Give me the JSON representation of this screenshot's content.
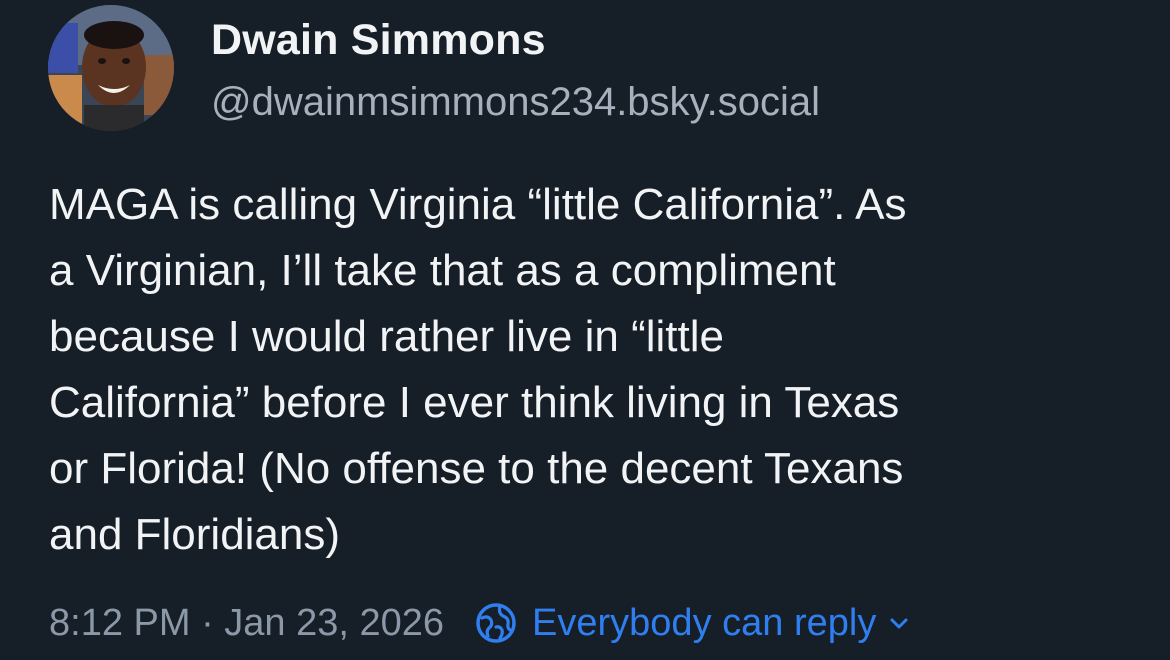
{
  "post": {
    "author": {
      "display_name": "Dwain Simmons",
      "handle": "@dwainmsimmons234.bsky.social"
    },
    "text": "MAGA is calling Virginia “little California”. As\na Virginian, I’ll take that as a compliment\nbecause I would rather live in “little\nCalifornia” before I ever think living in Texas\nor Florida! (No offense to the decent Texans\nand Floridians)",
    "timestamp": "8:12 PM · Jan 23, 2026",
    "reply_setting": {
      "label": "Everybody can reply",
      "icon": "globe-icon",
      "dropdown_icon": "chevron-down-icon"
    }
  },
  "colors": {
    "background": "#161e27",
    "primary_text": "#f1f3f5",
    "secondary_text": "#8b98a7",
    "accent": "#2f7ff0"
  }
}
